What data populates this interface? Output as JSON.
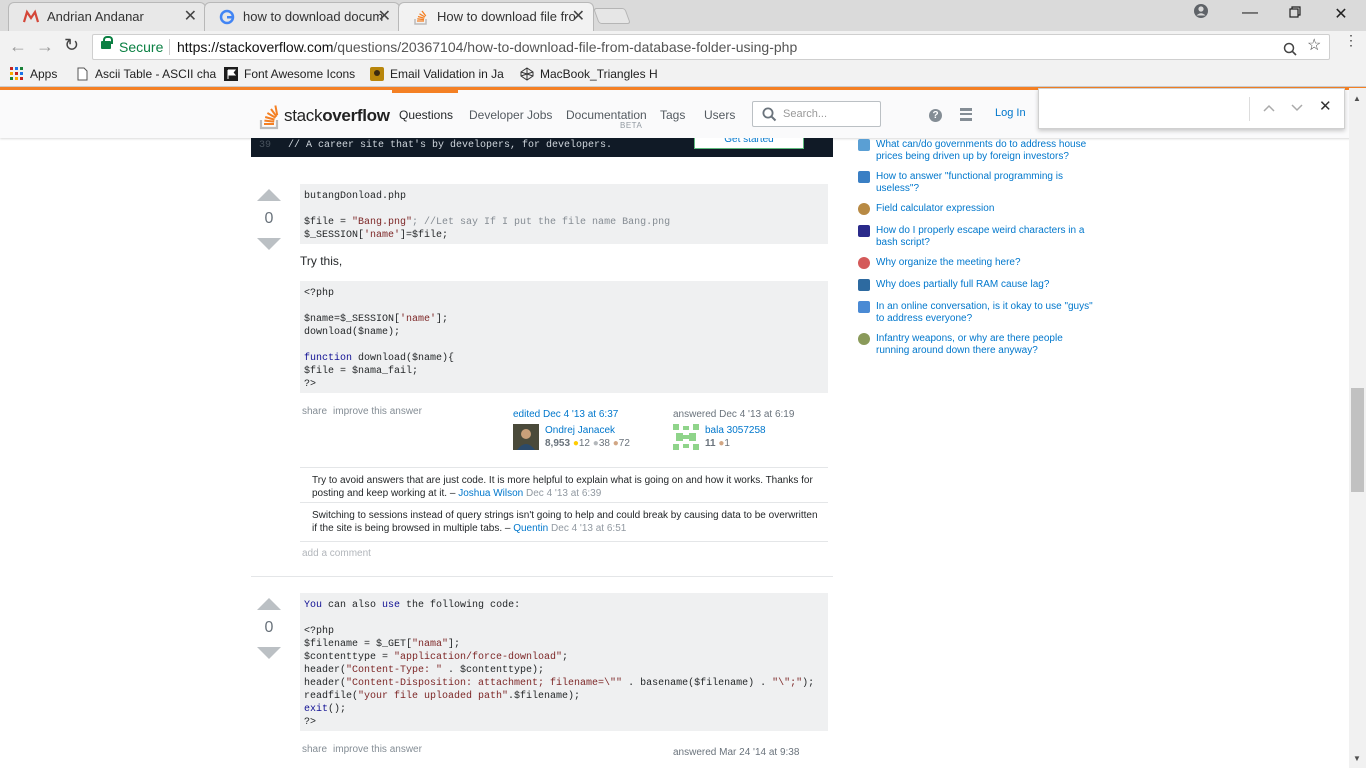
{
  "browser": {
    "tabs": [
      {
        "title": "Andrian Andanar",
        "icon": "gmail-icon"
      },
      {
        "title": "how to download docum",
        "icon": "google-icon"
      },
      {
        "title": "How to download file fro",
        "icon": "stackoverflow-icon"
      }
    ],
    "secure_label": "Secure",
    "url_host": "https://stackoverflow.com",
    "url_path": "/questions/20367104/how-to-download-file-from-database-folder-using-php",
    "bookmarks": [
      {
        "label": "Apps"
      },
      {
        "label": "Ascii Table - ASCII cha"
      },
      {
        "label": "Font Awesome Icons"
      },
      {
        "label": "Email Validation in Ja"
      },
      {
        "label": "MacBook_Triangles H"
      }
    ]
  },
  "so_header": {
    "logo_light": "stack",
    "logo_bold": "overflow",
    "nav": [
      "Questions",
      "Developer Jobs",
      "Documentation",
      "Tags",
      "Users"
    ],
    "beta_label": "BETA",
    "search_placeholder": "Search...",
    "login_label": "Log In"
  },
  "banner": {
    "line_number": "39",
    "code_text": "// A career site that's by developers, for developers.",
    "cta_label": "Get started"
  },
  "answer1": {
    "votes": "0",
    "code1": {
      "line1": "butangDonload.php",
      "line3a": "$file = ",
      "line3b": "\"Bang.png\"",
      "line3c": "; //Let say If I put the file name Bang.png",
      "line4a": "$_SESSION[",
      "line4b": "'name'",
      "line4c": "]=$file;"
    },
    "text": "Try this,",
    "code2": {
      "l1": "<?php",
      "l3a": "$name=$_SESSION[",
      "l3b": "'name'",
      "l3c": "];",
      "l4": "download($name);",
      "l6a": "function",
      "l6b": " download($name){",
      "l7": "$file = $nama_fail;",
      "l8": "?>"
    },
    "share": "share",
    "improve": "improve this answer",
    "edited_label": "edited Dec 4 '13 at 6:37",
    "editor_name": "Ondrej Janacek",
    "editor_rep": "8,953",
    "editor_gold": "12",
    "editor_silver": "38",
    "editor_bronze": "72",
    "answered_label": "answered Dec 4 '13 at 6:19",
    "author_name": "bala 3057258",
    "author_rep": "11",
    "author_bronze": "1",
    "comments": [
      {
        "text": "Try to avoid answers that are just code. It is more helpful to explain what is going on and how it works. Thanks for posting and keep working at it. – ",
        "user": "Joshua Wilson",
        "date": "Dec 4 '13 at 6:39"
      },
      {
        "text": "Switching to sessions instead of query strings isn't going to help and could break by causing data to be overwritten if the site is being browsed in multiple tabs. – ",
        "user": "Quentin",
        "date": "Dec 4 '13 at 6:51"
      }
    ],
    "add_comment": "add a comment"
  },
  "answer2": {
    "votes": "0",
    "code": {
      "l1a": "You",
      "l1b": " can also ",
      "l1c": "use",
      "l1d": " the following code:",
      "l3": "<?php",
      "l4a": "$filename = $_GET[",
      "l4b": "\"nama\"",
      "l4c": "];",
      "l5a": "$contenttype = ",
      "l5b": "\"application/force-download\"",
      "l5c": ";",
      "l6a": "header(",
      "l6b": "\"Content-Type: \"",
      "l6c": " . $contenttype);",
      "l7a": "header(",
      "l7b": "\"Content-Disposition: attachment; filename=\\\"\"",
      "l7c": " . basename($filename) . ",
      "l7d": "\"\\\";\"",
      "l7e": ");",
      "l8a": "readfile(",
      "l8b": "\"your file uploaded path\"",
      "l8c": ".$filename);",
      "l9a": "exit",
      "l9b": "();",
      "l10": "?>"
    },
    "share": "share",
    "improve": "improve this answer",
    "answered_label": "answered Mar 24 '14 at 9:38"
  },
  "hot_questions": [
    {
      "title": "What can/do governments do to address house prices being driven up by foreign investors?",
      "color": "#5a9fd4"
    },
    {
      "title": "How to answer \"functional programming is useless\"?",
      "color": "#3a7fc4"
    },
    {
      "title": "Field calculator expression",
      "color": "#b88a44"
    },
    {
      "title": "How do I properly escape weird characters in a bash script?",
      "color": "#2a2a8a"
    },
    {
      "title": "Why organize the meeting here?",
      "color": "#d45a5a"
    },
    {
      "title": "Why does partially full RAM cause lag?",
      "color": "#2d6aa0"
    },
    {
      "title": "In an online conversation, is it okay to use \"guys\" to address everyone?",
      "color": "#4a8ad4"
    },
    {
      "title": "Infantry weapons, or why are there people running around down there anyway?",
      "color": "#8a9a5a"
    }
  ]
}
